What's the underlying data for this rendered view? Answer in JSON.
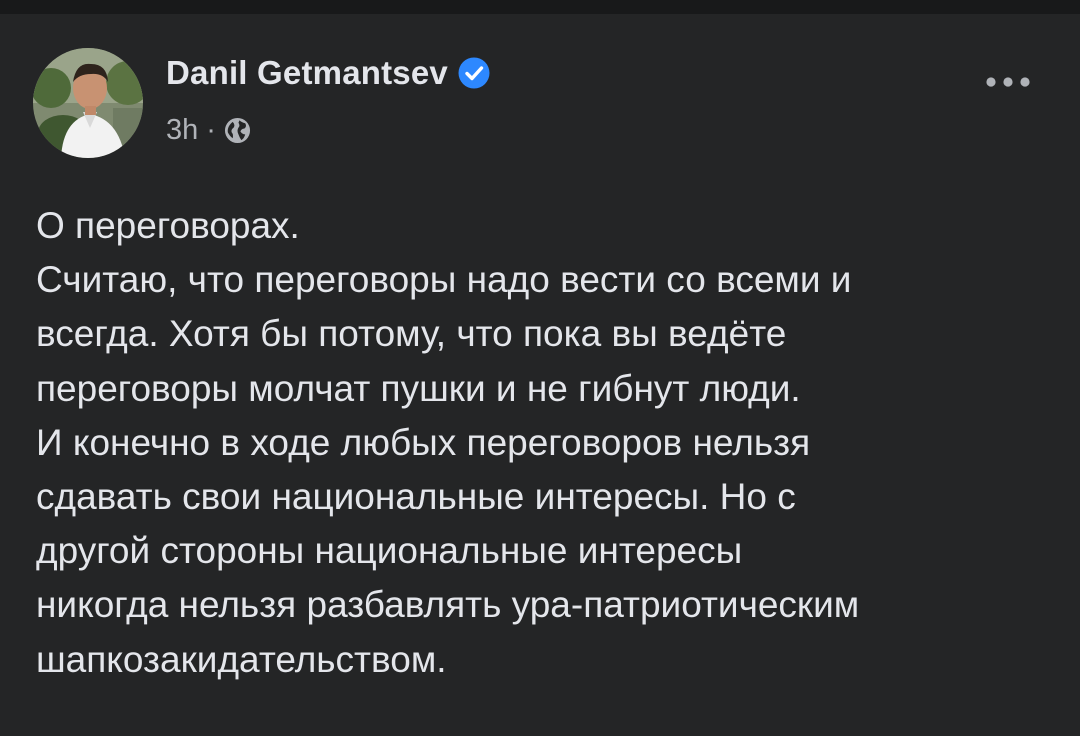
{
  "post": {
    "author": {
      "name": "Danil Getmantsev",
      "verified": true,
      "avatar_icon": "profile-photo"
    },
    "time": "3h",
    "separator": "·",
    "audience_icon": "globe-icon",
    "more_icon": "more-horizontal-icon",
    "lines": [
      "О переговорах.",
      "Считаю, что переговоры надо вести со всеми и",
      "всегда. Хотя бы потому, что пока вы ведёте",
      "переговоры молчат пушки и не гибнут люди.",
      "И конечно в ходе любых переговоров нельзя",
      "сдавать свои национальные интересы. Но с",
      "другой стороны национальные интересы",
      "никогда нельзя разбавлять ура-патриотическим",
      "шапкозакидательством."
    ]
  },
  "colors": {
    "background": "#242526",
    "top_strip": "#18191a",
    "primary_text": "#e4e6eb",
    "secondary_text": "#b0b3b8",
    "verified_badge": "#2d88ff"
  }
}
